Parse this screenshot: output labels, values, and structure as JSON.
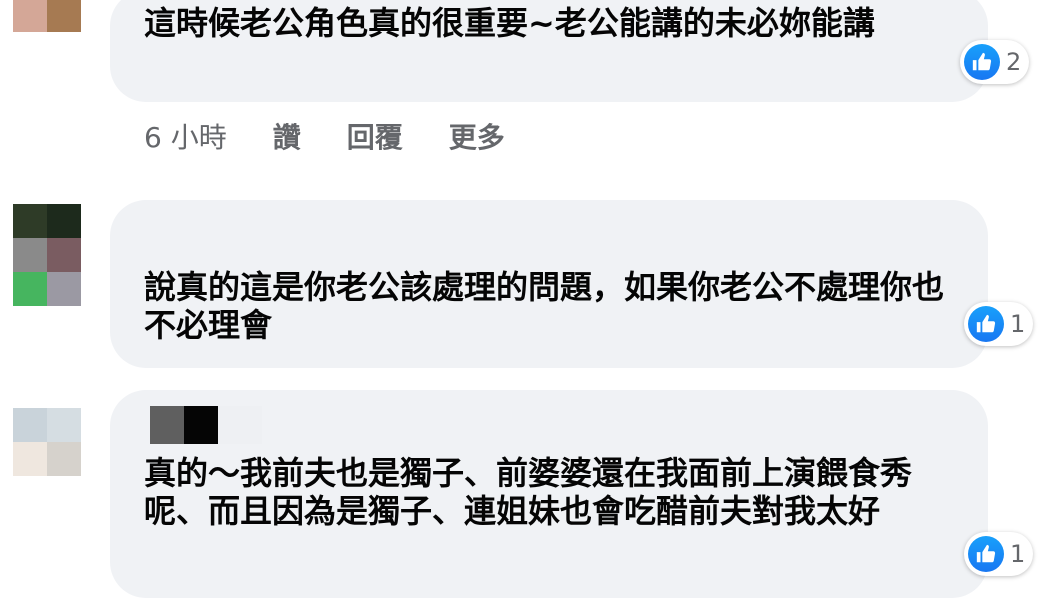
{
  "comments": [
    {
      "text": "這時候老公角色真的很重要~老公能講的未必妳能講",
      "reactions": "2",
      "meta": {
        "time": "6 小時",
        "like": "讚",
        "reply": "回覆",
        "more": "更多"
      }
    },
    {
      "text": "說真的這是你老公該處理的問題，如果你老公不處理你也不必理會",
      "reactions": "1"
    },
    {
      "text": "真的～我前夫也是獨子、前婆婆還在我面前上演餵食秀呢、而且因為是獨子、連姐妹也會吃醋前夫對我太好",
      "reactions": "1"
    }
  ],
  "colors": {
    "bubble": "#f0f2f5",
    "text": "#050505",
    "meta": "#65676b",
    "like": "#1877f2"
  },
  "icons": {
    "reaction": "like-thumb-icon"
  }
}
